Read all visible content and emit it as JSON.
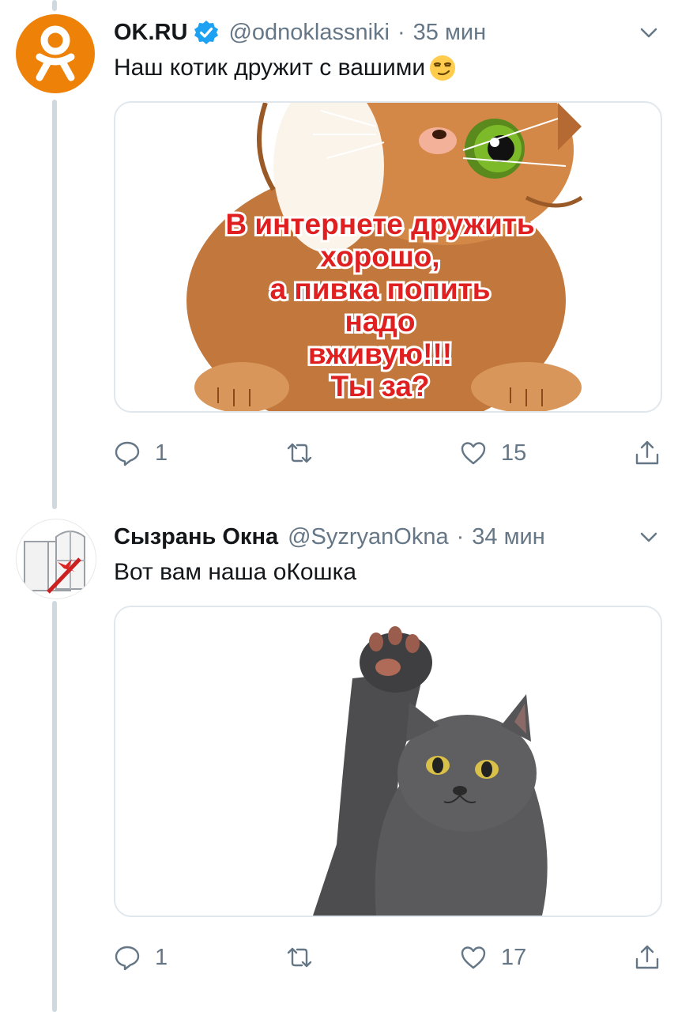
{
  "tweets": [
    {
      "name": "OK.RU",
      "verified": true,
      "handle": "@odnoklassniki",
      "separator": "·",
      "time": "35 мин",
      "text": "Наш котик дружит с вашими",
      "emoji": "smirking-face",
      "image_caption_lines": [
        "В  интернете дружить",
        "хорошо,",
        "а пивка попить",
        "надо",
        "вживую!!!",
        "Ты за?"
      ],
      "stats": {
        "replies": "1",
        "retweets": "",
        "likes": "15"
      }
    },
    {
      "name": "Сызрань Окна",
      "verified": false,
      "handle": "@SyzryanOkna",
      "separator": "·",
      "time": "34 мин",
      "text": "Вот вам наша оКошка",
      "stats": {
        "replies": "1",
        "retweets": "",
        "likes": "17"
      }
    }
  ],
  "colors": {
    "text": "#14171a",
    "secondary": "#657786",
    "verified": "#1da1f2",
    "ok_orange": "#ee8208",
    "thread_line": "#cfd9de",
    "border": "#e1e8ed"
  }
}
